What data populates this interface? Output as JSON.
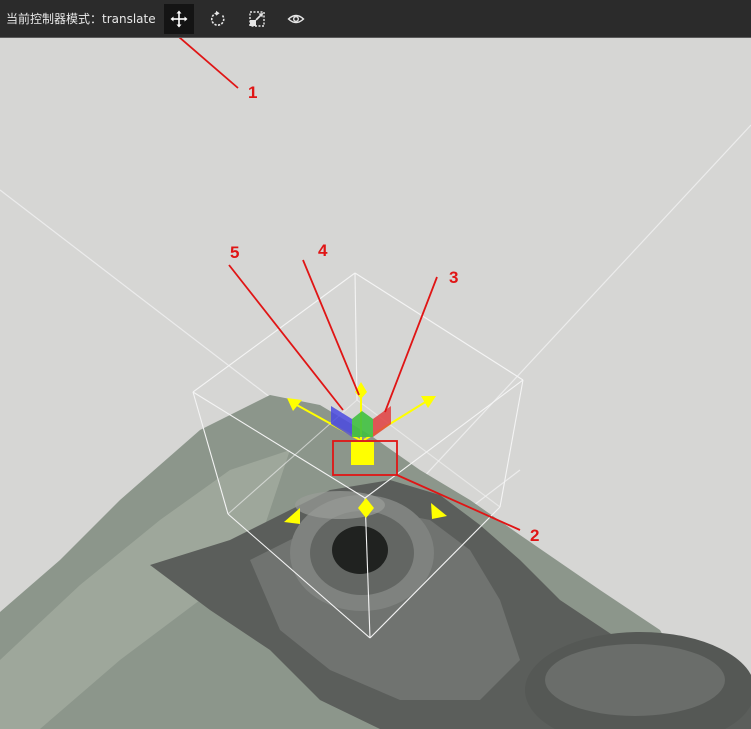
{
  "toolbar": {
    "mode_label": "当前控制器模式：translate",
    "buttons": [
      {
        "icon": "move-arrows-icon",
        "active": true
      },
      {
        "icon": "rotate-icon",
        "active": false
      },
      {
        "icon": "scale-icon",
        "active": false
      },
      {
        "icon": "eye-icon",
        "active": false
      }
    ]
  },
  "annotations": [
    {
      "label": "1"
    },
    {
      "label": "2"
    },
    {
      "label": "3"
    },
    {
      "label": "4"
    },
    {
      "label": "5"
    }
  ],
  "colors": {
    "toolbar_bg": "#2b2b2b",
    "viewport_bg": "#d6d6d4",
    "annotation": "#e01515",
    "gizmo_yellow": "#ffff00",
    "axis_red": "#e04040",
    "axis_green": "#40c040",
    "axis_blue": "#4a4ae0"
  }
}
